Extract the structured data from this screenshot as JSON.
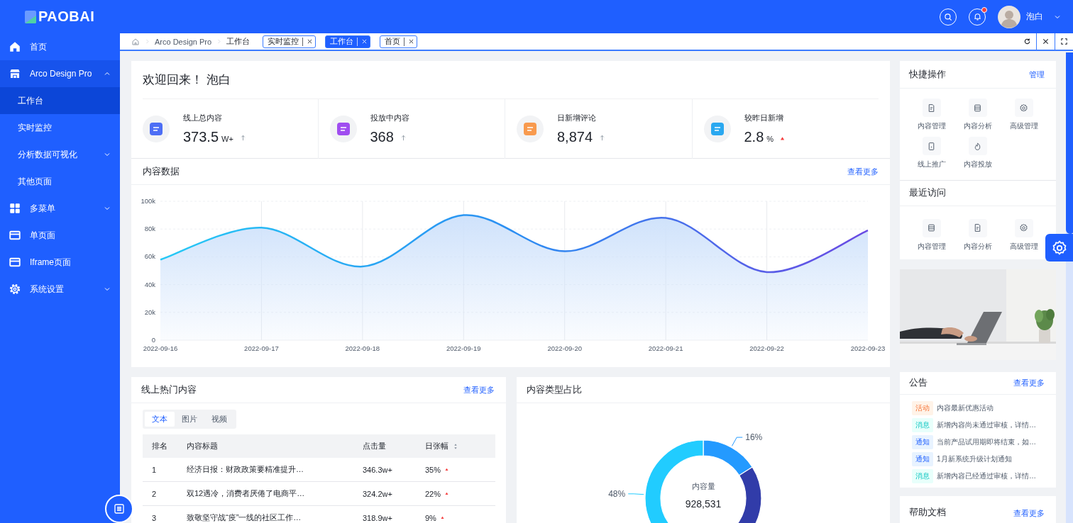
{
  "header": {
    "logo": "PAOBAI",
    "user_name": "泡白",
    "notification_dot": true
  },
  "sidebar": {
    "items": [
      {
        "label": "首页",
        "kind": "home",
        "selected": false
      },
      {
        "label": "Arco Design Pro",
        "kind": "store",
        "selected": false,
        "expanded": true,
        "children": [
          {
            "label": "工作台",
            "selected": true
          },
          {
            "label": "实时监控",
            "selected": false
          },
          {
            "label": "分析数据可视化",
            "selected": false,
            "expanded": false
          },
          {
            "label": "其他页面",
            "selected": false
          }
        ]
      },
      {
        "label": "多菜单",
        "kind": "grid",
        "selected": false,
        "expanded": false
      },
      {
        "label": "单页面",
        "kind": "window",
        "selected": false
      },
      {
        "label": "Iframe页面",
        "kind": "window",
        "selected": false
      },
      {
        "label": "系统设置",
        "kind": "gear",
        "selected": false,
        "expanded": false
      }
    ]
  },
  "breadcrumb": [
    "Arco Design Pro",
    "工作台"
  ],
  "page_tabs": [
    {
      "label": "实时监控",
      "selected": false
    },
    {
      "label": "工作台",
      "selected": true
    },
    {
      "label": "首页",
      "selected": false
    }
  ],
  "welcome": {
    "title": "欢迎回来！ 泡白",
    "stats": [
      {
        "label": "线上总内容",
        "value": "373.5",
        "unit": "W+",
        "kind": "arrow",
        "color": "#4d6ef5"
      },
      {
        "label": "投放中内容",
        "value": "368",
        "kind": "arrow",
        "color": "#a04df0"
      },
      {
        "label": "日新增评论",
        "value": "8,874",
        "kind": "arrow",
        "color": "#f89a4e"
      },
      {
        "label": "较昨日新增",
        "value": "2.8",
        "unit": "%",
        "kind": "triangle",
        "color": "#2aa8f0"
      }
    ]
  },
  "content_data": {
    "title": "内容数据",
    "more": "查看更多",
    "chart_data": {
      "type": "area",
      "x": [
        "2022-09-16",
        "2022-09-17",
        "2022-09-18",
        "2022-09-19",
        "2022-09-20",
        "2022-09-21",
        "2022-09-22",
        "2022-09-23"
      ],
      "series": [
        {
          "color": "#2b8ef2",
          "values": [
            58000,
            81000,
            53000,
            90000,
            64000,
            88000,
            49000,
            79000
          ]
        }
      ],
      "grid": true,
      "ylim": [
        0,
        100000
      ],
      "yticks": [
        {
          "value": 0,
          "label": "0"
        },
        {
          "value": 20000,
          "label": "20k"
        },
        {
          "value": 40000,
          "label": "40k"
        },
        {
          "value": 60000,
          "label": "60k"
        },
        {
          "value": 80000,
          "label": "80k"
        },
        {
          "value": 100000,
          "label": "100k"
        }
      ]
    }
  },
  "hot_content": {
    "title": "线上热门内容",
    "more": "查看更多",
    "tabs": [
      {
        "label": "文本",
        "selected": true
      },
      {
        "label": "图片",
        "selected": false
      },
      {
        "label": "视频",
        "selected": false
      }
    ],
    "columns": [
      {
        "label": "排名"
      },
      {
        "label": "内容标题"
      },
      {
        "label": "点击量"
      },
      {
        "label": "日张幅",
        "sortable": true
      }
    ],
    "rows": [
      {
        "rank": "1",
        "title": "经济日报：财政政策要精准提升…",
        "clicks": "346.3w+",
        "change": "35%"
      },
      {
        "rank": "2",
        "title": "双12遇冷，消费者厌倦了电商平…",
        "clicks": "324.2w+",
        "change": "22%"
      },
      {
        "rank": "3",
        "title": "致敬坚守战“疫”一线的社区工作…",
        "clicks": "318.9w+",
        "change": "9%"
      }
    ]
  },
  "content_types": {
    "title": "内容类型占比",
    "center_label": "内容量",
    "center_value": "928,531",
    "chart_data": {
      "type": "donut",
      "values": [
        16,
        36,
        48
      ],
      "value_labels": [
        "16%",
        null,
        "48%"
      ]
    }
  },
  "quick_ops": {
    "title": "快捷操作",
    "manage": "管理",
    "items": [
      {
        "label": "内容管理",
        "kind": "doc"
      },
      {
        "label": "内容分析",
        "kind": "list"
      },
      {
        "label": "高级管理",
        "kind": "gear"
      },
      {
        "label": "线上推广",
        "kind": "tablet"
      },
      {
        "label": "内容投放",
        "kind": "fire"
      }
    ]
  },
  "recent": {
    "title": "最近访问",
    "items": [
      {
        "label": "内容管理",
        "kind": "list"
      },
      {
        "label": "内容分析",
        "kind": "doc"
      },
      {
        "label": "高级管理",
        "kind": "gear"
      }
    ]
  },
  "banner": {
    "kind": "picture"
  },
  "notices": {
    "title": "公告",
    "more": "查看更多",
    "items": [
      {
        "tag": "活动",
        "kind": "activity",
        "text": "内容最新优惠活动"
      },
      {
        "tag": "消息",
        "kind": "message",
        "text": "新增内容尚未通过审核，详情…"
      },
      {
        "tag": "通知",
        "kind": "notice",
        "text": "当前产品试用期即将结束，如…"
      },
      {
        "tag": "通知",
        "kind": "notice",
        "text": "1月新系统升级计划通知"
      },
      {
        "tag": "消息",
        "kind": "message",
        "text": "新增内容已经通过审核，详情…"
      }
    ]
  },
  "help": {
    "title": "帮助文档",
    "more": "查看更多"
  }
}
